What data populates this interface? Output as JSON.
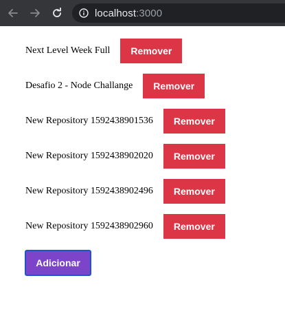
{
  "browser": {
    "url_host": "localhost",
    "url_port": ":3000"
  },
  "repositories": [
    {
      "title": "Next Level Week Full",
      "remove_label": "Remover"
    },
    {
      "title": "Desafio 2 - Node Challange",
      "remove_label": "Remover"
    },
    {
      "title": "New Repository 1592438901536",
      "remove_label": "Remover"
    },
    {
      "title": "New Repository 1592438902020",
      "remove_label": "Remover"
    },
    {
      "title": "New Repository 1592438902496",
      "remove_label": "Remover"
    },
    {
      "title": "New Repository 1592438902960",
      "remove_label": "Remover"
    }
  ],
  "add_label": "Adicionar",
  "colors": {
    "remove": "#dc3545",
    "add": "#7c44c8",
    "add_border": "#1a55c9"
  }
}
